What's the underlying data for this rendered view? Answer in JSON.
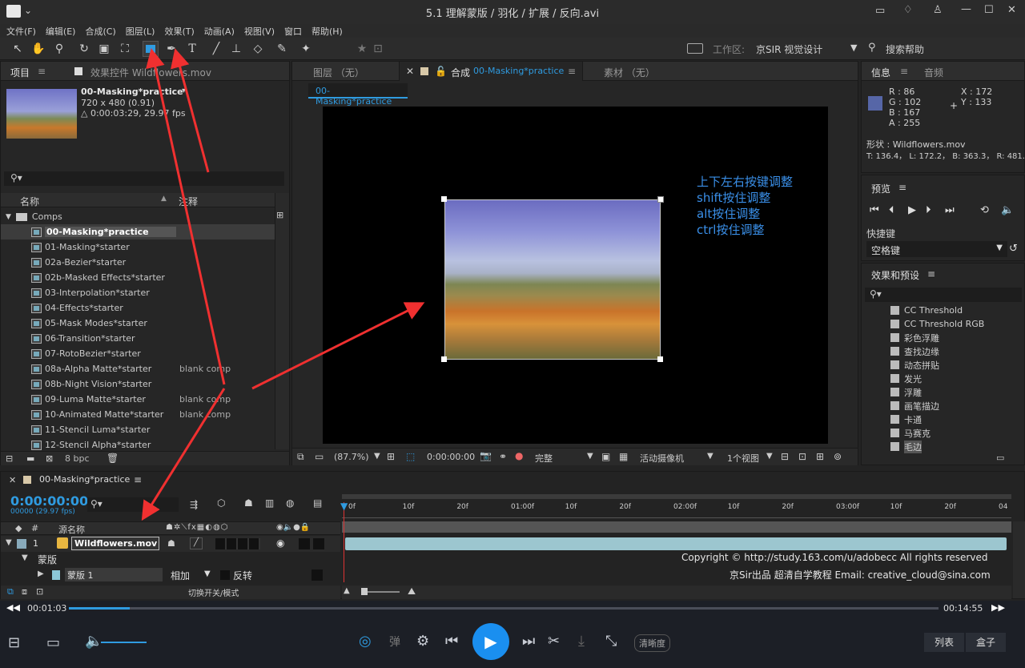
{
  "window": {
    "title": "5.1 理解蒙版 / 羽化 / 扩展 / 反向.avi"
  },
  "menu": [
    "文件(F)",
    "编辑(E)",
    "合成(C)",
    "图层(L)",
    "效果(T)",
    "动画(A)",
    "视图(V)",
    "窗口",
    "帮助(H)"
  ],
  "toolbar": {
    "workspace_label": "工作区:",
    "workspace_value": "京SIR 视觉设计",
    "search_help": "搜索帮助"
  },
  "project": {
    "tab_project": "项目",
    "tab_effects": "效果控件 Wildflowers.mov",
    "comp_name": "00-Masking*practice",
    "comp_size": "720 x 480 (0.91)",
    "comp_dur": "△ 0:00:03:29, 29.97 fps",
    "col_name": "名称",
    "col_comment": "注释",
    "folder": "Comps",
    "bpc": "8 bpc",
    "items": [
      {
        "name": "00-Masking*practice",
        "comment": ""
      },
      {
        "name": "01-Masking*starter",
        "comment": ""
      },
      {
        "name": "02a-Bezier*starter",
        "comment": ""
      },
      {
        "name": "02b-Masked Effects*starter",
        "comment": ""
      },
      {
        "name": "03-Interpolation*starter",
        "comment": ""
      },
      {
        "name": "04-Effects*starter",
        "comment": ""
      },
      {
        "name": "05-Mask Modes*starter",
        "comment": ""
      },
      {
        "name": "06-Transition*starter",
        "comment": ""
      },
      {
        "name": "07-RotoBezier*starter",
        "comment": ""
      },
      {
        "name": "08a-Alpha Matte*starter",
        "comment": "blank comp"
      },
      {
        "name": "08b-Night Vision*starter",
        "comment": ""
      },
      {
        "name": "09-Luma Matte*starter",
        "comment": "blank comp"
      },
      {
        "name": "10-Animated Matte*starter",
        "comment": "blank comp"
      },
      {
        "name": "11-Stencil Luma*starter",
        "comment": ""
      },
      {
        "name": "12-Stencil Alpha*starter",
        "comment": ""
      }
    ]
  },
  "viewer": {
    "tab_layer": "图层 （无）",
    "tab_comp": "合成",
    "tab_comp_name": "00-Masking*practice",
    "tab_footage": "素材 （无）",
    "breadcrumb": "00-Masking*practice",
    "notes": [
      "上下左右按键调整",
      "shift按住调整",
      "alt按住调整",
      "ctrl按住调整"
    ],
    "zoom": "(87.7%)",
    "time": "0:00:00:00",
    "quality": "完整",
    "camera": "活动摄像机",
    "views": "1个视图"
  },
  "info": {
    "tab_info": "信息",
    "tab_audio": "音频",
    "r": "R : 86",
    "g": "G : 102",
    "b": "B : 167",
    "a": "A : 255",
    "x": "X : 172",
    "y": "Y : 133",
    "shape": "形状 : Wildflowers.mov",
    "bounds": "T: 136.4， L: 172.2， B: 363.3， R: 481.",
    "swatch": "#5666a7"
  },
  "preview": {
    "title": "预览",
    "shortcut_label": "快捷键",
    "shortcut_value": "空格键"
  },
  "effects": {
    "title": "效果和预设",
    "items": [
      "CC Threshold",
      "CC Threshold RGB",
      "彩色浮雕",
      "查找边缘",
      "动态拼贴",
      "发光",
      "浮雕",
      "画笔描边",
      "卡通",
      "马赛克",
      "毛边"
    ]
  },
  "timeline": {
    "tab": "00-Masking*practice",
    "timecode": "0:00:00:00",
    "frames": "00000 (29.97 fps)",
    "col_source": "源名称",
    "layer_num": "1",
    "layer_name": "Wildflowers.mov",
    "mask_group": "蒙版",
    "mask_name": "蒙版 1",
    "mode": "相加",
    "invert": "反转",
    "toggle": "切换开关/模式",
    "ruler": [
      "0f",
      "10f",
      "20f",
      "01:00f",
      "10f",
      "20f",
      "02:00f",
      "10f",
      "20f",
      "03:00f",
      "10f",
      "20f",
      "04"
    ],
    "copyright1": "Copyright © http://study.163.com/u/adobecc All rights reserved",
    "copyright2": "京Sir出品 超清自学教程 Email: creative_cloud@sina.com"
  },
  "player": {
    "current": "00:01:03",
    "total": "00:14:55",
    "progress": 0.07,
    "danmu": "弹",
    "clarity": "清晰度",
    "list": "列表",
    "box": "盒子"
  }
}
